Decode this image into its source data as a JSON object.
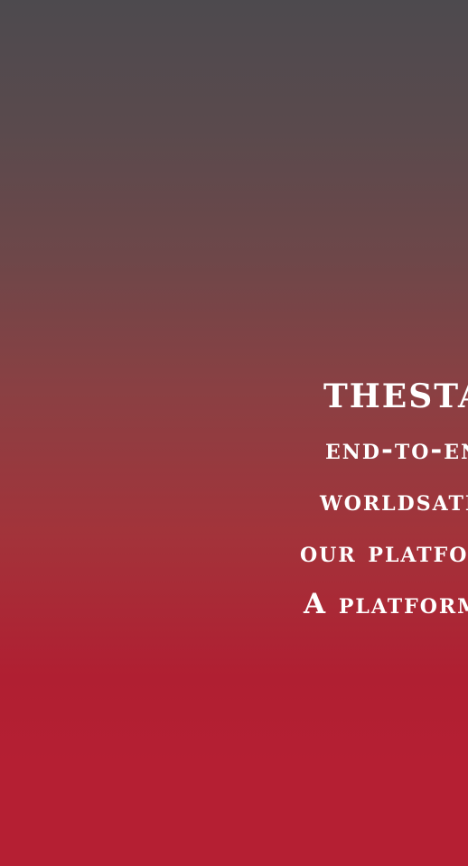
{
  "hero": {
    "title": "THESTART",
    "line2": "end-to-end",
    "line3": "worldsatellite",
    "line4": "our platform",
    "line5": "A platform"
  }
}
